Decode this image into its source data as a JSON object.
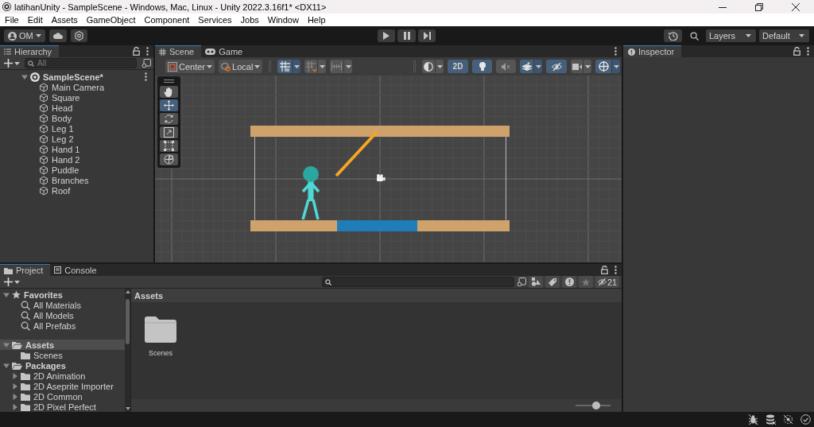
{
  "window": {
    "title": "latihanUnity - SampleScene - Windows, Mac, Linux - Unity 2022.3.16f1* <DX11>"
  },
  "menu": [
    "File",
    "Edit",
    "Assets",
    "GameObject",
    "Component",
    "Services",
    "Jobs",
    "Window",
    "Help"
  ],
  "toolbar": {
    "account": "OM",
    "layers": "Layers",
    "layout": "Default"
  },
  "hierarchy": {
    "title": "Hierarchy",
    "search": {
      "placeholder": "All"
    },
    "tree": [
      {
        "label": "SampleScene*",
        "kind": "scene",
        "expanded": true,
        "selected": false,
        "children": [
          {
            "label": "Main Camera",
            "kind": "object",
            "selected": false
          },
          {
            "label": "Square",
            "kind": "object",
            "selected": false
          },
          {
            "label": "Head",
            "kind": "object",
            "selected": false
          },
          {
            "label": "Body",
            "kind": "object",
            "selected": false
          },
          {
            "label": "Leg 1",
            "kind": "object",
            "selected": false
          },
          {
            "label": "Leg 2",
            "kind": "object",
            "selected": false
          },
          {
            "label": "Hand 1",
            "kind": "object",
            "selected": false
          },
          {
            "label": "Hand 2",
            "kind": "object",
            "selected": false
          },
          {
            "label": "Puddle",
            "kind": "object",
            "selected": false
          },
          {
            "label": "Branches",
            "kind": "object",
            "selected": false
          },
          {
            "label": "Roof",
            "kind": "object",
            "selected": false
          }
        ]
      }
    ]
  },
  "scene_view": {
    "tabs": [
      {
        "label": "Scene",
        "kind": "scene",
        "selected": true
      },
      {
        "label": "Game",
        "kind": "game",
        "selected": false
      }
    ],
    "pivot": "Center",
    "space": "Local",
    "snapping": [
      {
        "kind": "grid",
        "on": true
      },
      {
        "kind": "increment",
        "on": false
      },
      {
        "kind": "ruler",
        "on": false
      }
    ],
    "toggles": [
      {
        "kind": "shading",
        "on": false
      },
      {
        "kind": "mode",
        "label": "2D",
        "on": true
      },
      {
        "kind": "lighting",
        "on": true
      },
      {
        "kind": "audio",
        "on": false
      },
      {
        "kind": "effects",
        "on": true
      },
      {
        "kind": "visibility",
        "on": true
      },
      {
        "kind": "camera",
        "on": false
      },
      {
        "kind": "gizmos",
        "on": true
      }
    ],
    "tools": [
      {
        "kind": "hand",
        "selected": false
      },
      {
        "kind": "move",
        "selected": true
      },
      {
        "kind": "rotate",
        "selected": false
      },
      {
        "kind": "scale",
        "selected": false
      },
      {
        "kind": "rect",
        "selected": false
      },
      {
        "kind": "transform",
        "selected": false
      }
    ]
  },
  "inspector": {
    "title": "Inspector"
  },
  "project": {
    "tabs": [
      {
        "label": "Project",
        "kind": "project",
        "selected": true
      },
      {
        "label": "Console",
        "kind": "console",
        "selected": false
      }
    ],
    "hidden_count": "21",
    "tree": [
      {
        "label": "Favorites",
        "kind": "star",
        "expanded": true,
        "selected": false,
        "children": [
          {
            "label": "All Materials",
            "kind": "search",
            "selected": false
          },
          {
            "label": "All Models",
            "kind": "search",
            "selected": false
          },
          {
            "label": "All Prefabs",
            "kind": "search",
            "selected": false
          }
        ]
      },
      {
        "label": "Assets",
        "kind": "folder",
        "expanded": true,
        "selected": true,
        "children": [
          {
            "label": "Scenes",
            "kind": "folder",
            "selected": false
          }
        ]
      },
      {
        "label": "Packages",
        "kind": "folder",
        "expanded": true,
        "selected": false,
        "children": [
          {
            "label": "2D Animation",
            "kind": "folder",
            "expanded": false,
            "selected": false
          },
          {
            "label": "2D Aseprite Importer",
            "kind": "folder",
            "expanded": false,
            "selected": false
          },
          {
            "label": "2D Common",
            "kind": "folder",
            "expanded": false,
            "selected": false
          },
          {
            "label": "2D Pixel Perfect",
            "kind": "folder",
            "expanded": false,
            "selected": false
          }
        ]
      }
    ],
    "breadcrumb": "Assets",
    "items": [
      {
        "label": "Scenes",
        "kind": "folder"
      }
    ],
    "zoom": {
      "level": 0.58
    }
  }
}
